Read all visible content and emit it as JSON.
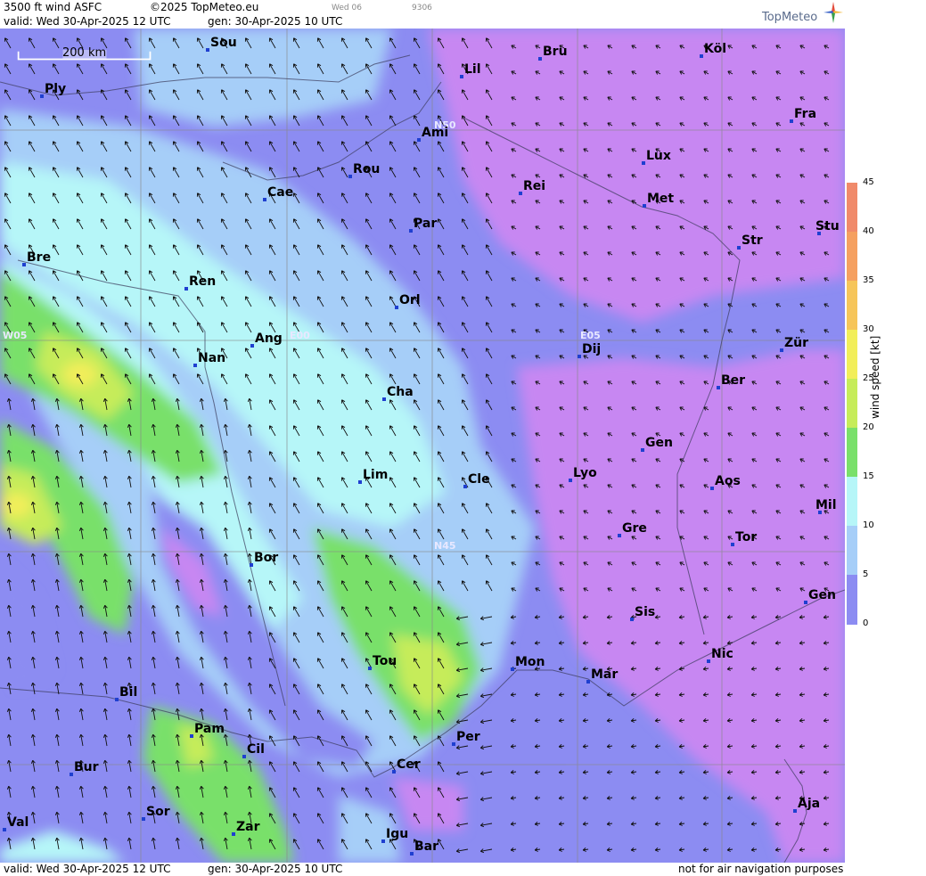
{
  "header": {
    "product": "3500 ft wind ASFC",
    "copyright": "©2025 TopMeteo.eu",
    "small1": "Wed 06",
    "small2": "9306",
    "valid": "valid:  Wed  30-Apr-2025  12 UTC",
    "gen": "gen: 30-Apr-2025 10 UTC",
    "logo": "TopMeteo"
  },
  "footer": {
    "valid": "valid:  Wed  30-Apr-2025  12 UTC",
    "gen": "gen: 30-Apr-2025 10 UTC",
    "disclaimer": "not for air navigation purposes"
  },
  "scale_label": "200 km",
  "grid_labels": [
    "N50",
    "N45",
    "W05",
    "E00",
    "E05"
  ],
  "colorbar": {
    "title": "wind  speed  [kt]",
    "ticks": [
      "45",
      "40",
      "35",
      "30",
      "25",
      "20",
      "15",
      "10",
      "5",
      "0"
    ],
    "colors": [
      "#f08a6a",
      "#f5a060",
      "#f6c55a",
      "#f2ee5a",
      "#c6ec5a",
      "#79e06a",
      "#b6f6f8",
      "#a6cef8",
      "#8c8cf2",
      "#c787f2"
    ]
  },
  "cities": [
    {
      "name": "Sou"
    },
    {
      "name": "Bru"
    },
    {
      "name": "Köl"
    },
    {
      "name": "Ply"
    },
    {
      "name": "Lil"
    },
    {
      "name": "Fra"
    },
    {
      "name": "Ami"
    },
    {
      "name": "Lux"
    },
    {
      "name": "Rou"
    },
    {
      "name": "Cae"
    },
    {
      "name": "Rei"
    },
    {
      "name": "Met"
    },
    {
      "name": "Par"
    },
    {
      "name": "Str"
    },
    {
      "name": "Stu"
    },
    {
      "name": "Bre"
    },
    {
      "name": "Ren"
    },
    {
      "name": "Orl"
    },
    {
      "name": "Ang"
    },
    {
      "name": "Dij"
    },
    {
      "name": "Zür"
    },
    {
      "name": "Nan"
    },
    {
      "name": "Ber"
    },
    {
      "name": "Cha"
    },
    {
      "name": "Gen"
    },
    {
      "name": "Lim"
    },
    {
      "name": "Cle"
    },
    {
      "name": "Lyo"
    },
    {
      "name": "Aos"
    },
    {
      "name": "Mil"
    },
    {
      "name": "Gre"
    },
    {
      "name": "Tor"
    },
    {
      "name": "Bor"
    },
    {
      "name": "Gen"
    },
    {
      "name": "Sis"
    },
    {
      "name": "Nic"
    },
    {
      "name": "Tou"
    },
    {
      "name": "Mon"
    },
    {
      "name": "Mar"
    },
    {
      "name": "Bil"
    },
    {
      "name": "Pam"
    },
    {
      "name": "Per"
    },
    {
      "name": "Cil"
    },
    {
      "name": "Bur"
    },
    {
      "name": "Cer"
    },
    {
      "name": "Aja"
    },
    {
      "name": "Sor"
    },
    {
      "name": "Val"
    },
    {
      "name": "Zar"
    },
    {
      "name": "Igu"
    },
    {
      "name": "Bar"
    }
  ]
}
